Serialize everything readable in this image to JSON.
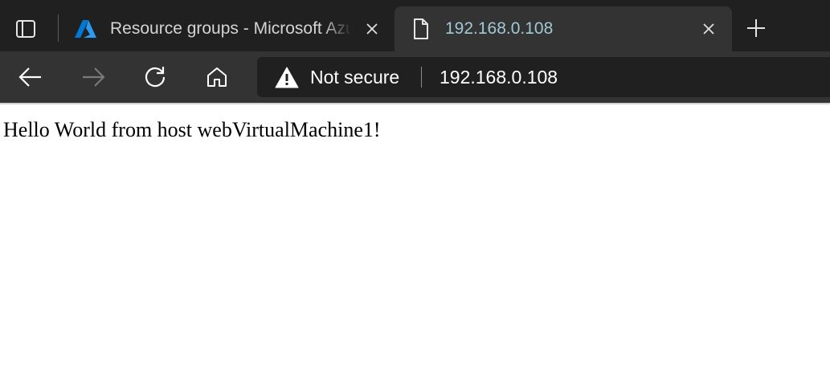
{
  "browser": {
    "tabs": [
      {
        "title": "Resource groups - Microsoft Azure",
        "favicon": "azure-logo-icon",
        "active": false
      },
      {
        "title": "192.168.0.108",
        "favicon": "page-document-icon",
        "active": true
      }
    ],
    "tab_actions_icon": "tab-actions-icon",
    "new_tab_icon": "plus-icon",
    "close_icon": "close-icon"
  },
  "toolbar": {
    "buttons": [
      {
        "name": "back",
        "icon": "back-arrow-icon",
        "enabled": true
      },
      {
        "name": "forward",
        "icon": "forward-arrow-icon",
        "enabled": false
      },
      {
        "name": "refresh",
        "icon": "refresh-icon",
        "enabled": true
      },
      {
        "name": "home",
        "icon": "home-icon",
        "enabled": true
      }
    ],
    "address": {
      "security_icon": "warning-triangle-icon",
      "security_label": "Not secure",
      "url": "192.168.0.108"
    }
  },
  "page": {
    "body_text": "Hello World from host webVirtualMachine1!"
  },
  "colors": {
    "tab_strip": "#202020",
    "active_tab": "#333333",
    "toolbar": "#333333",
    "address_bar": "#202020",
    "azure_blue": "#0078d4"
  }
}
